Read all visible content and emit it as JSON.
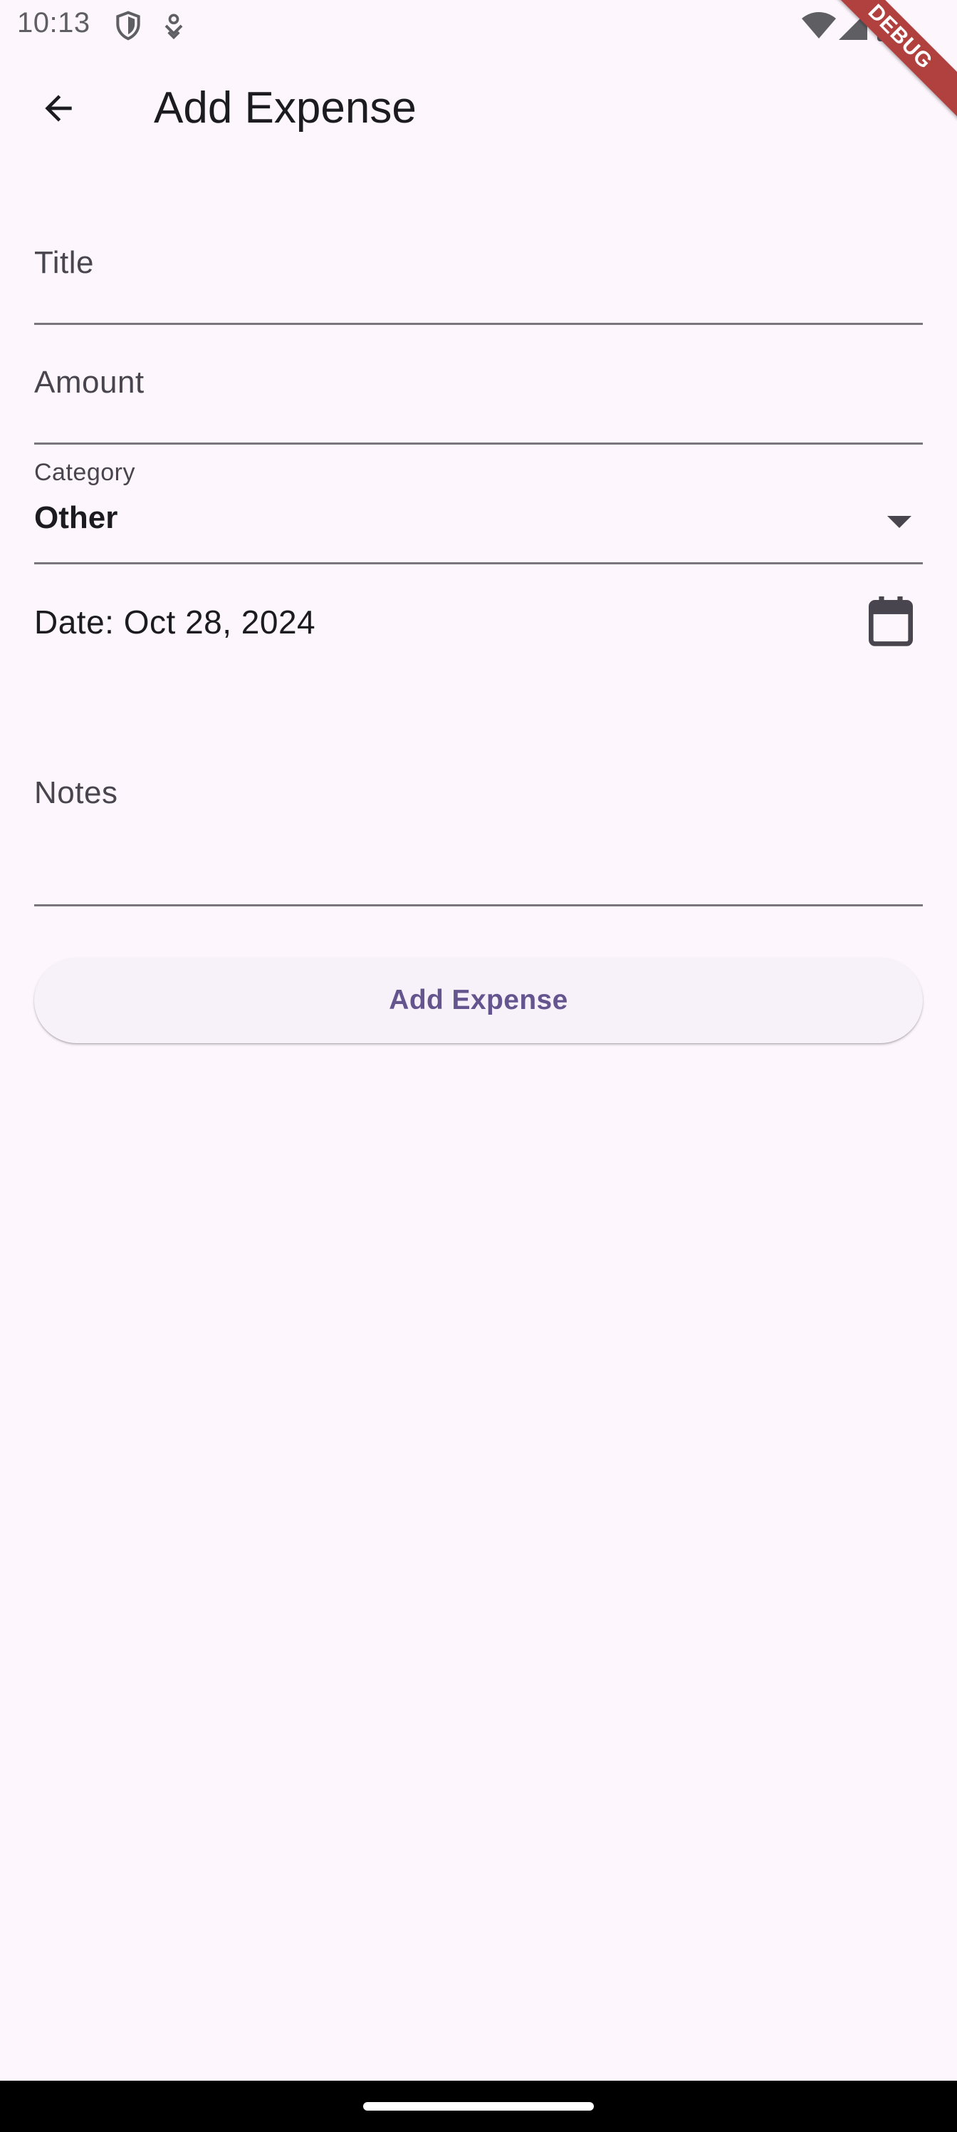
{
  "status_bar": {
    "time": "10:13"
  },
  "debug_banner": {
    "label": "DEBUG"
  },
  "app_bar": {
    "title": "Add Expense"
  },
  "form": {
    "title_field": {
      "placeholder": "Title",
      "value": ""
    },
    "amount_field": {
      "placeholder": "Amount",
      "value": ""
    },
    "category_field": {
      "label": "Category",
      "selected": "Other"
    },
    "date_row": {
      "text": "Date: Oct 28, 2024"
    },
    "notes_field": {
      "placeholder": "Notes",
      "value": ""
    },
    "submit_label": "Add Expense"
  },
  "colors": {
    "background": "#fdf7fd",
    "accent": "#65558f",
    "button_surface": "#f7f2fa",
    "underline": "#79747e",
    "debug_ribbon": "#b0413e"
  },
  "icons": {
    "back": "arrow-back-icon",
    "dropdown": "dropdown-arrow-icon",
    "calendar": "calendar-icon",
    "status": [
      "vpn-shield-icon",
      "location-icon",
      "wifi-icon",
      "cellular-signal-icon",
      "battery-icon"
    ]
  }
}
